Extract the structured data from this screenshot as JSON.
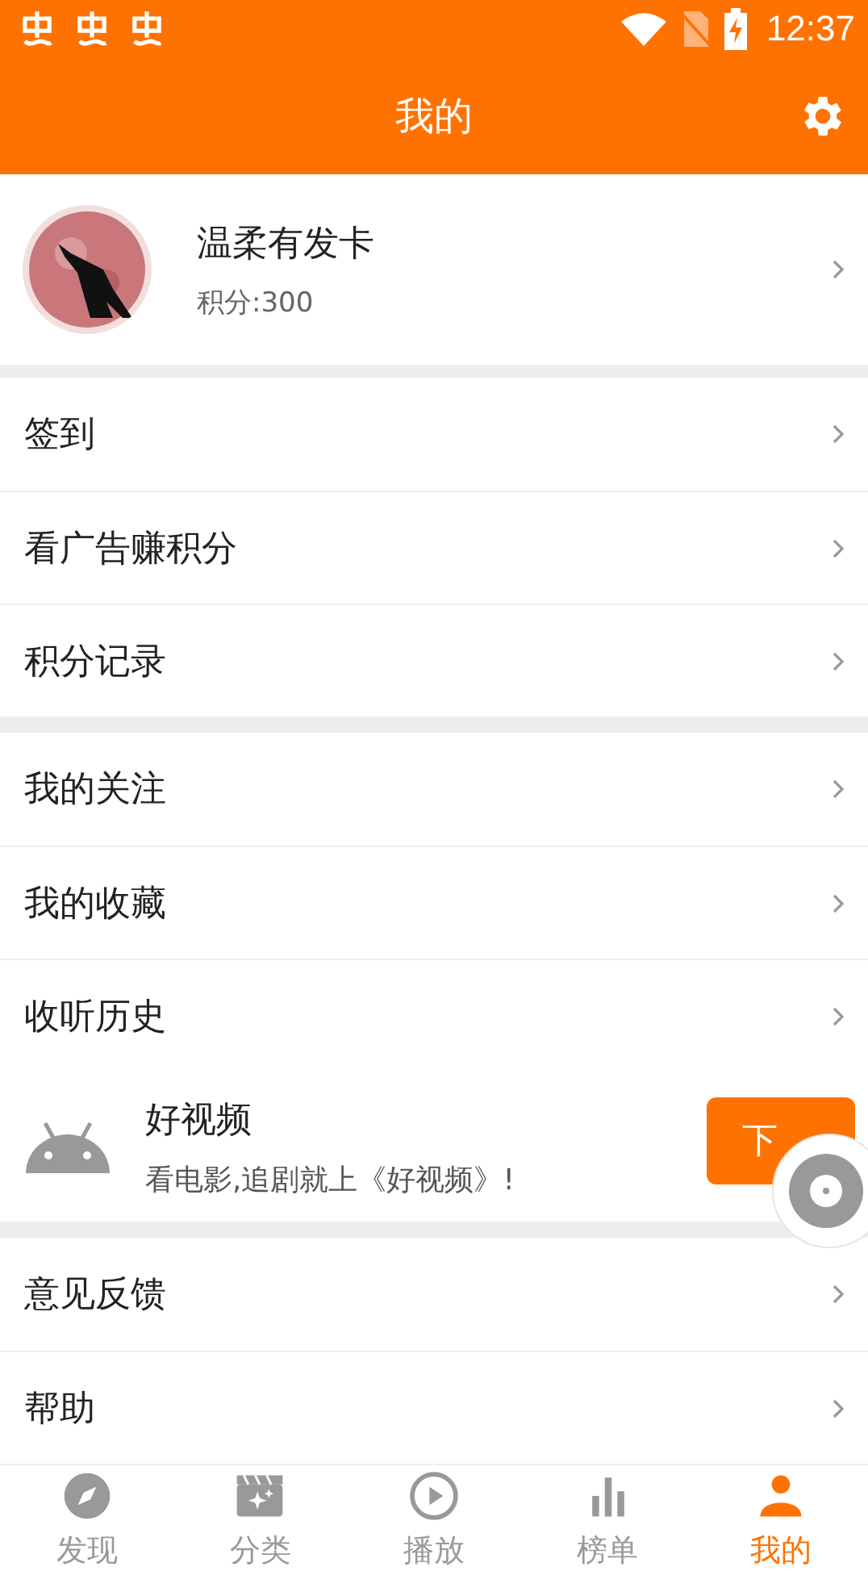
{
  "status_bar": {
    "time": "12:37"
  },
  "header": {
    "title": "我的"
  },
  "profile": {
    "name": "温柔有发卡",
    "points": "积分:300"
  },
  "menu_groups": [
    {
      "items": [
        {
          "label": "签到"
        },
        {
          "label": "看广告赚积分"
        },
        {
          "label": "积分记录"
        }
      ]
    },
    {
      "items": [
        {
          "label": "我的关注"
        },
        {
          "label": "我的收藏"
        },
        {
          "label": "收听历史"
        }
      ],
      "ad": {
        "title": "好视频",
        "description": "看电影,追剧就上《好视频》!",
        "button": "下"
      }
    },
    {
      "items": [
        {
          "label": "意见反馈"
        },
        {
          "label": "帮助"
        }
      ]
    }
  ],
  "bottom_nav": [
    {
      "label": "发现",
      "kind": "compass",
      "selected": false
    },
    {
      "label": "分类",
      "kind": "clapper",
      "selected": false
    },
    {
      "label": "播放",
      "kind": "play",
      "selected": false
    },
    {
      "label": "榜单",
      "kind": "chart",
      "selected": false
    },
    {
      "label": "我的",
      "kind": "person",
      "selected": true
    }
  ]
}
